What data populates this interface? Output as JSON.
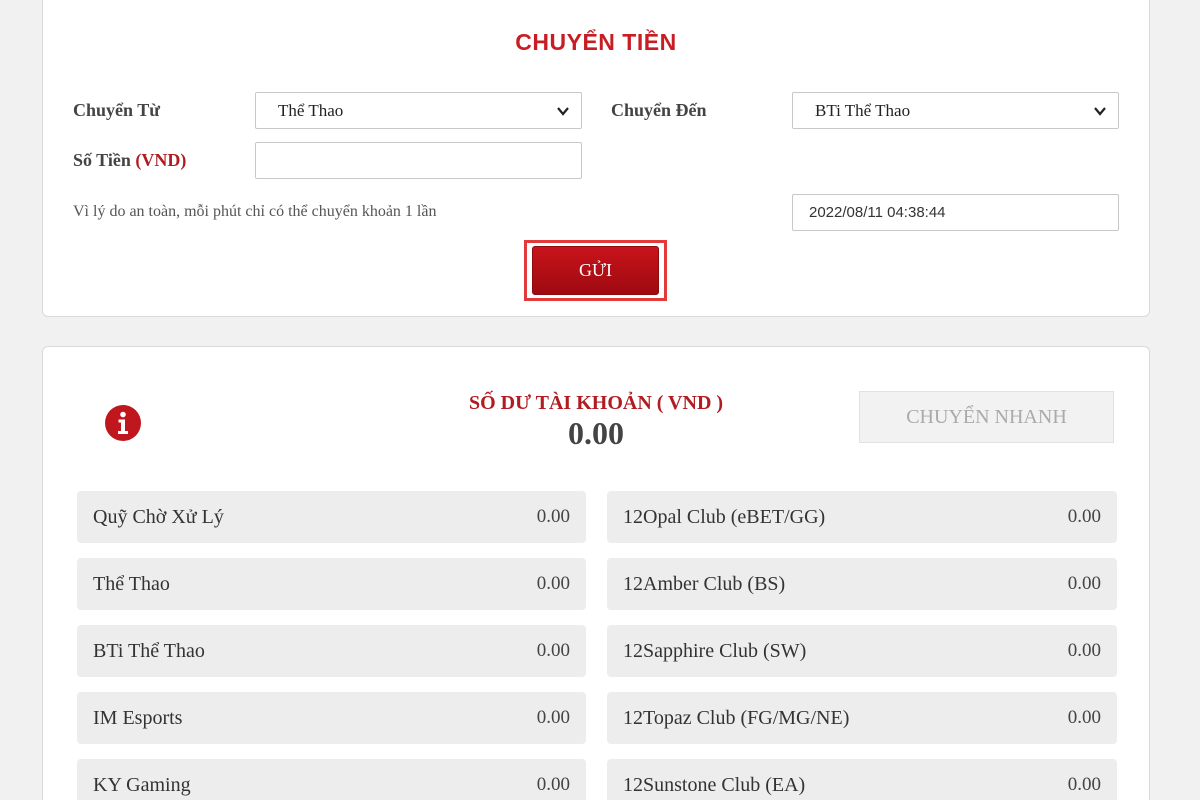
{
  "transfer": {
    "title": "CHUYỂN TIỀN",
    "from_label": "Chuyển Từ",
    "from_value": "Thể Thao",
    "to_label": "Chuyển Đến",
    "to_value": "BTi Thể Thao",
    "amount_label": "Số Tiền",
    "amount_unit": "(VND)",
    "amount_value": "",
    "notice": "Vì lý do an toàn, mỗi phút chỉ có thể chuyển khoản 1 lần",
    "datetime": "2022/08/11 04:38:44",
    "submit_label": "GỬI"
  },
  "balance": {
    "heading": "SỐ DƯ TÀI KHOẢN ( VND )",
    "total": "0.00",
    "quick_transfer_label": "CHUYỂN NHANH",
    "wallets": [
      {
        "name": "Quỹ Chờ Xử Lý",
        "amount": "0.00"
      },
      {
        "name": "12Opal Club (eBET/GG)",
        "amount": "0.00"
      },
      {
        "name": "Thể Thao",
        "amount": "0.00"
      },
      {
        "name": "12Amber Club (BS)",
        "amount": "0.00"
      },
      {
        "name": "BTi Thể Thao",
        "amount": "0.00"
      },
      {
        "name": "12Sapphire Club (SW)",
        "amount": "0.00"
      },
      {
        "name": "IM Esports",
        "amount": "0.00"
      },
      {
        "name": "12Topaz Club (FG/MG/NE)",
        "amount": "0.00"
      },
      {
        "name": "KY Gaming",
        "amount": "0.00"
      },
      {
        "name": "12Sunstone Club (EA)",
        "amount": "0.00"
      }
    ]
  },
  "colors": {
    "brand_red": "#c81d25",
    "button_red": "#b00f16",
    "highlight_outline": "#e23a3a",
    "info_icon": "#c0161e"
  },
  "icons": {
    "info": "info-circle-icon",
    "dropdown": "chevron-down-icon"
  }
}
